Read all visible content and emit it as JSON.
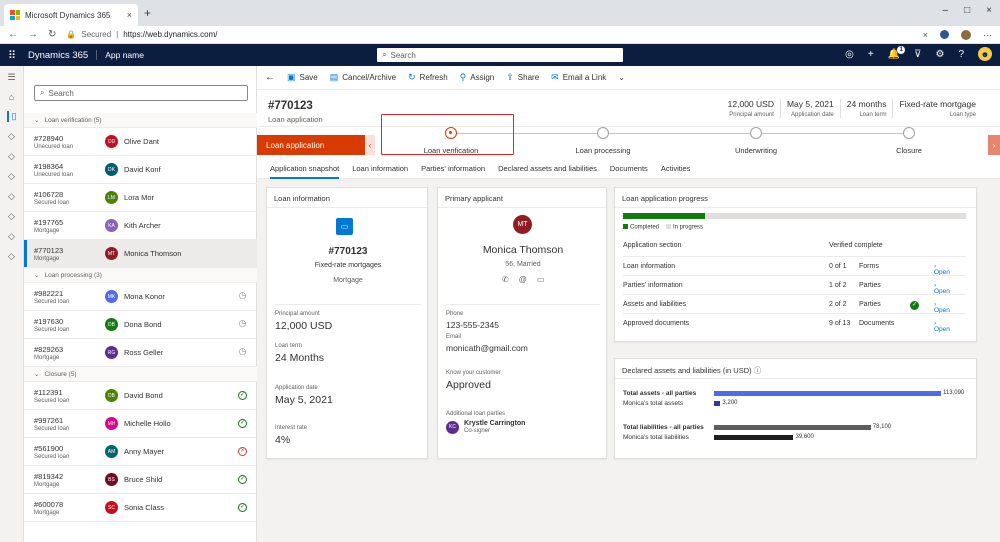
{
  "browser": {
    "tab_title": "Microsoft Dynamics 365",
    "tab_close": "×",
    "new_tab": "+",
    "url_secured": "Secured",
    "url_separator": "|",
    "url": "https://web.dynamics.com/",
    "window_controls": [
      "–",
      "□",
      "×"
    ],
    "ms_logo_colors": [
      "#f25022",
      "#7fba00",
      "#00a4ef",
      "#ffb900"
    ]
  },
  "d365": {
    "title": "Dynamics 365",
    "app_name": "App name",
    "search_placeholder": "Search",
    "notif_count": "1"
  },
  "list": {
    "search_placeholder": "Search",
    "groups": [
      {
        "label": "Loan verification (5)",
        "rows": [
          {
            "id": "#728940",
            "type": "Unecured loan",
            "initials": "OD",
            "name": "Olive Dant",
            "color": "#c50f1f"
          },
          {
            "id": "#198364",
            "type": "Unecured loan",
            "initials": "DK",
            "name": "David Konf",
            "color": "#005b70"
          },
          {
            "id": "#106728",
            "type": "Secured loan",
            "initials": "LM",
            "name": "Lora Mor",
            "color": "#498205"
          },
          {
            "id": "#197765",
            "type": "Mortgage",
            "initials": "KA",
            "name": "Kith Archer",
            "color": "#8764b8"
          },
          {
            "id": "#770123",
            "type": "Mortgage",
            "initials": "MT",
            "name": "Monica Thomson",
            "color": "#8f1d21",
            "selected": true
          }
        ]
      },
      {
        "label": "Loan processing (3)",
        "rows": [
          {
            "id": "#982221",
            "type": "Secured loan",
            "initials": "MK",
            "name": "Mona Konor",
            "color": "#4f6bed",
            "status": "pending"
          },
          {
            "id": "#197630",
            "type": "Secured loan",
            "initials": "DB",
            "name": "Dona Bond",
            "color": "#107c10",
            "status": "pending"
          },
          {
            "id": "#829263",
            "type": "Mortgage",
            "initials": "RG",
            "name": "Ross Geller",
            "color": "#5c2d91",
            "status": "pending"
          }
        ]
      },
      {
        "label": "Closure (5)",
        "rows": [
          {
            "id": "#112391",
            "type": "Secured loan",
            "initials": "DB",
            "name": "David Bond",
            "color": "#498205",
            "status": "done"
          },
          {
            "id": "#997261",
            "type": "Secured loan",
            "initials": "MH",
            "name": "Michelle Hollo",
            "color": "#e3008c",
            "status": "done"
          },
          {
            "id": "#561900",
            "type": "Secured loan",
            "initials": "AM",
            "name": "Anny Mayer",
            "color": "#00666d",
            "status": "failed"
          },
          {
            "id": "#819342",
            "type": "Mortgage",
            "initials": "BS",
            "name": "Bruce Shild",
            "color": "#750b1c",
            "status": "done"
          },
          {
            "id": "#600078",
            "type": "Mortgage",
            "initials": "SC",
            "name": "Sonia Class",
            "color": "#c50f1f",
            "status": "done"
          }
        ]
      }
    ]
  },
  "commands": {
    "save": "Save",
    "cancel": "Cancel/Archive",
    "refresh": "Refresh",
    "assign": "Assign",
    "share": "Share",
    "email": "Email a Link"
  },
  "record": {
    "title": "#770123",
    "subtitle": "Loan application",
    "header_fields": [
      {
        "value": "12,000 USD",
        "label": "Principal amount"
      },
      {
        "value": "May 5, 2021",
        "label": "Application date"
      },
      {
        "value": "24 months",
        "label": "Loan term"
      },
      {
        "value": "Fixed-rate mortgage",
        "label": "Loan type"
      }
    ]
  },
  "stages": {
    "active": "Loan application",
    "list": [
      "Loan verification",
      "Loan processing",
      "Underwriting",
      "Closure"
    ]
  },
  "tabs": [
    "Application snapshot",
    "Loan information",
    "Parties' information",
    "Declared assets and liabilities",
    "Documents",
    "Activities"
  ],
  "loan_info": {
    "title": "Loan information",
    "number": "#770123",
    "product": "Fixed-rate mortgages",
    "category": "Mortgage",
    "fields": [
      {
        "label": "Principal amount",
        "value": "12,000 USD"
      },
      {
        "label": "Loan term",
        "value": "24 Months"
      },
      {
        "label": "Application date",
        "value": "May 5, 2021"
      },
      {
        "label": "Interest rate",
        "value": "4%"
      }
    ]
  },
  "applicant": {
    "title": "Primary applicant",
    "initials": "MT",
    "name": "Monica Thomson",
    "details": "56, Married",
    "phone_label": "Phone",
    "phone": "123-555-2345",
    "email_label": "Email",
    "email": "monicath@gmail.com",
    "kyc_label": "Know your customer",
    "kyc": "Approved",
    "additional_label": "Additional loan parties",
    "cosigner_initials": "KC",
    "cosigner_name": "Krystle Carrington",
    "cosigner_role": "Co-signer"
  },
  "progress": {
    "title": "Loan application progress",
    "completed_fraction": 0.24,
    "legend_completed": "Completed",
    "legend_in_progress": "In progress",
    "col_section": "Application section",
    "col_verified": "Verified complete",
    "open_label": "Open",
    "rows": [
      {
        "section": "Loan information",
        "count": "0 of 1",
        "unit": "Forms"
      },
      {
        "section": "Parties' information",
        "count": "1 of 2",
        "unit": "Parties"
      },
      {
        "section": "Assets and liabilities",
        "count": "2 of 2",
        "unit": "Parties",
        "complete": true
      },
      {
        "section": "Approved documents",
        "count": "9 of 13",
        "unit": "Documents"
      }
    ]
  },
  "declared": {
    "title": "Declared assets and liabilities (in USD)",
    "assets_all_label": "Total assets - all parties",
    "assets_all": 113090,
    "assets_all_text": "113,090",
    "assets_monica_label": "Monica's total assets",
    "assets_monica": 3200,
    "assets_monica_text": "3,200",
    "liab_all_label": "Total liabilities - all parties",
    "liab_all": 78100,
    "liab_all_text": "78,100",
    "liab_monica_label": "Monica's total liabilities",
    "liab_monica": 39600,
    "liab_monica_text": "39,600",
    "asset_color": "#4f6bed",
    "asset_monica_color": "#2b3a9e",
    "liab_color": "#605e5c",
    "liab_monica_color": "#201f1e"
  }
}
